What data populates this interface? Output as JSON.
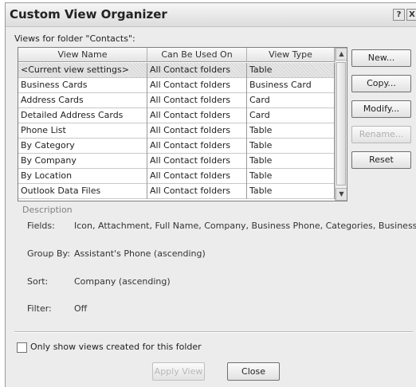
{
  "window": {
    "title": "Custom View Organizer",
    "help_glyph": "?",
    "close_glyph": "X"
  },
  "views_label": "Views for folder \"Contacts\":",
  "table": {
    "columns": [
      "View Name",
      "Can Be Used On",
      "View Type"
    ],
    "rows": [
      {
        "name": "<Current view settings>",
        "used_on": "All Contact folders",
        "type": "Table",
        "selected": true
      },
      {
        "name": "Business Cards",
        "used_on": "All Contact folders",
        "type": "Business Card"
      },
      {
        "name": "Address Cards",
        "used_on": "All Contact folders",
        "type": "Card"
      },
      {
        "name": "Detailed Address Cards",
        "used_on": "All Contact folders",
        "type": "Card"
      },
      {
        "name": "Phone List",
        "used_on": "All Contact folders",
        "type": "Table"
      },
      {
        "name": "By Category",
        "used_on": "All Contact folders",
        "type": "Table"
      },
      {
        "name": "By Company",
        "used_on": "All Contact folders",
        "type": "Table"
      },
      {
        "name": "By Location",
        "used_on": "All Contact folders",
        "type": "Table"
      },
      {
        "name": "Outlook Data Files",
        "used_on": "All Contact folders",
        "type": "Table"
      }
    ]
  },
  "buttons": {
    "new": "New...",
    "copy": "Copy...",
    "modify": "Modify...",
    "rename": "Rename...",
    "reset": "Reset"
  },
  "description": {
    "heading": "Description",
    "fields_label": "Fields:",
    "fields_value": "Icon, Attachment, Full Name, Company, Business Phone, Categories, Business F",
    "group_by_label": "Group By:",
    "group_by_value": "Assistant's Phone (ascending)",
    "sort_label": "Sort:",
    "sort_value": "Company (ascending)",
    "filter_label": "Filter:",
    "filter_value": "Off"
  },
  "only_show_checkbox": {
    "label": "Only show views created for this folder",
    "checked": false
  },
  "footer": {
    "apply_view": "Apply View",
    "close": "Close"
  }
}
